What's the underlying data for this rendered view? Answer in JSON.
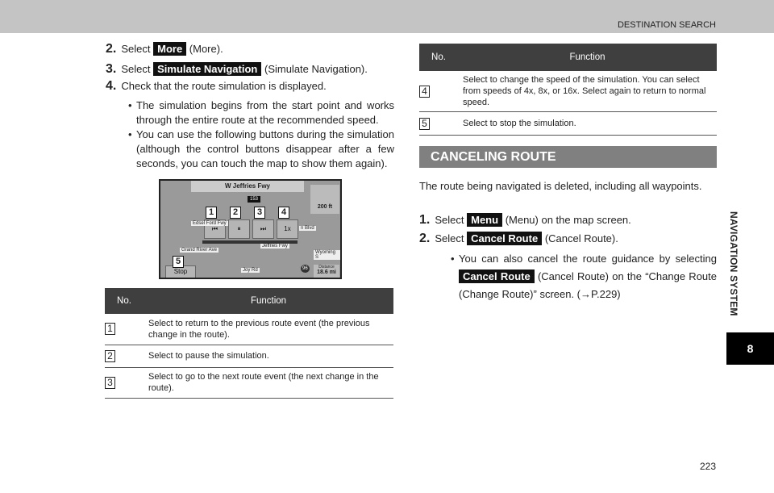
{
  "header": {
    "title": "DESTINATION SEARCH"
  },
  "left": {
    "steps": [
      {
        "num": "2.",
        "pre": "Select",
        "key": "More",
        "post": "(More)."
      },
      {
        "num": "3.",
        "pre": "Select",
        "key": "Simulate Navigation",
        "post": "(Simulate Navigation)."
      },
      {
        "num": "4.",
        "text": "Check that the route simulation is displayed."
      }
    ],
    "bullets": [
      "The simulation begins from the start point and works through the entire route at the recommended speed.",
      "You can use the following buttons during the simulation (although the control buttons disappear after a few seconds, you can touch the map to show them again)."
    ],
    "map": {
      "road_top": "W Jeffries Fwy",
      "shield": "153",
      "distance_turn": "200 ft",
      "labels": [
        "Edsel Ford Fwy",
        "n Blvd",
        "Grand River Ave",
        "Jeffries Fwy",
        "Wyoming S",
        "Joy Rd"
      ],
      "stop": "Stop",
      "speed": "1x",
      "shield2": "96",
      "distance_label": "Distance",
      "distance": "18.6 mi",
      "callouts": [
        "1",
        "2",
        "3",
        "4",
        "5"
      ]
    }
  },
  "table_left": {
    "headers": [
      "No.",
      "Function"
    ],
    "rows": [
      {
        "no": "1",
        "text": "Select to return to the previous route event (the previous change in the route)."
      },
      {
        "no": "2",
        "text": "Select to pause the simulation."
      },
      {
        "no": "3",
        "text": "Select to go to the next route event (the next change in the route)."
      }
    ]
  },
  "table_right": {
    "headers": [
      "No.",
      "Function"
    ],
    "rows": [
      {
        "no": "4",
        "text": "Select to change the speed of the simulation. You can select from speeds of 4x, 8x, or 16x. Select again to return to normal speed."
      },
      {
        "no": "5",
        "text": "Select to stop the simulation."
      }
    ]
  },
  "cancel": {
    "title": "CANCELING ROUTE",
    "intro": "The route being navigated is deleted, including all waypoints.",
    "steps": [
      {
        "num": "1.",
        "pre": "Select",
        "key": "Menu",
        "post": "(Menu) on the map screen."
      },
      {
        "num": "2.",
        "pre": "Select",
        "key": "Cancel Route",
        "post": "(Cancel Route)."
      }
    ],
    "bullet_pre": "You can also cancel the route guidance by selecting",
    "bullet_key": "Cancel Route",
    "bullet_post": "(Cancel Route) on the “Change Route (Change Route)” screen. (→P.229)"
  },
  "sidebar": {
    "section": "NAVIGATION SYSTEM",
    "chapter": "8"
  },
  "footer": {
    "page": "223"
  }
}
